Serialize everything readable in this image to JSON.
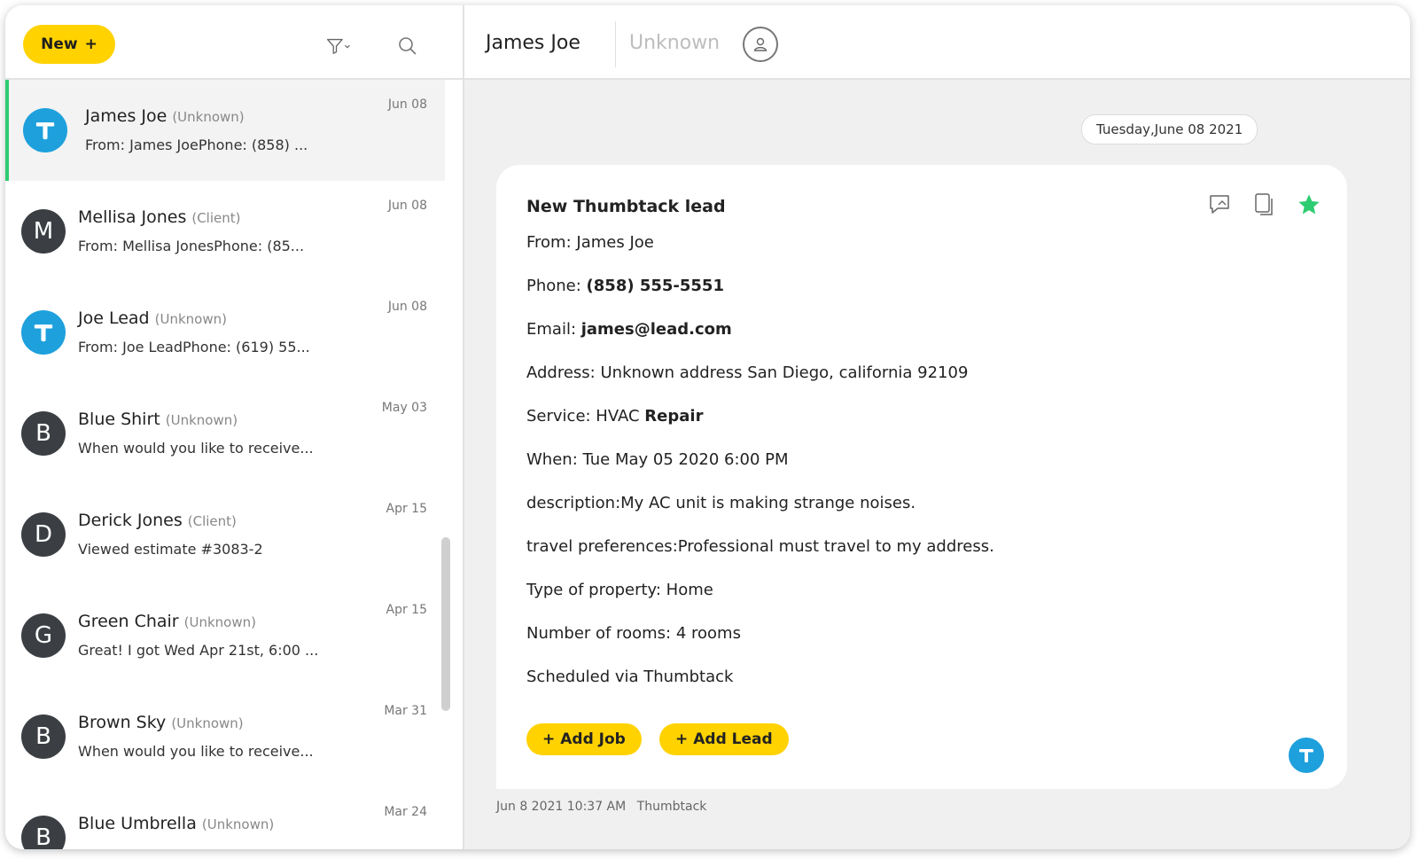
{
  "left": {
    "new_button": "New",
    "new_plus": "+",
    "conversations": [
      {
        "name": "James Joe",
        "role": "(Unknown)",
        "preview": "From: James JoePhone: (858) ...",
        "date": "Jun 08",
        "avatar": "T",
        "source": "thumbtack",
        "selected": true
      },
      {
        "name": "Mellisa Jones",
        "role": "(Client)",
        "preview": "From: Mellisa JonesPhone: (85...",
        "date": "Jun 08",
        "avatar": "M",
        "source": "letter"
      },
      {
        "name": "Joe Lead",
        "role": "(Unknown)",
        "preview": "From: Joe LeadPhone: (619) 55...",
        "date": "Jun 08",
        "avatar": "T",
        "source": "thumbtack"
      },
      {
        "name": "Blue Shirt",
        "role": "(Unknown)",
        "preview": "When would you like to receive...",
        "date": "May 03",
        "avatar": "B",
        "source": "letter"
      },
      {
        "name": "Derick Jones",
        "role": "(Client)",
        "preview": "Viewed estimate #3083-2",
        "date": "Apr 15",
        "avatar": "D",
        "source": "letter"
      },
      {
        "name": "Green Chair",
        "role": "(Unknown)",
        "preview": "Great! I got Wed Apr 21st, 6:00 ...",
        "date": "Apr 15",
        "avatar": "G",
        "source": "letter"
      },
      {
        "name": "Brown Sky",
        "role": "(Unknown)",
        "preview": "When would you like to receive...",
        "date": "Mar 31",
        "avatar": "B",
        "source": "letter"
      },
      {
        "name": "Blue Umbrella",
        "role": "(Unknown)",
        "preview": "",
        "date": "Mar 24",
        "avatar": "B",
        "source": "letter"
      }
    ]
  },
  "header": {
    "contact_name": "James Joe",
    "contact_status": "Unknown"
  },
  "thread": {
    "date_label": "Tuesday,June 08 2021",
    "message": {
      "title": "New Thumbtack lead",
      "lines": [
        {
          "label": "From: ",
          "value": "James Joe",
          "bold": false
        },
        {
          "label": "Phone: ",
          "value": "(858) 555-5551",
          "bold": true
        },
        {
          "label": "Email: ",
          "value": "james@lead.com",
          "bold": true
        },
        {
          "label": "Address: ",
          "value": "Unknown address San Diego, california 92109",
          "bold": false
        },
        {
          "label": "Service: HVAC ",
          "value": "Repair",
          "bold": true
        },
        {
          "label": "When: ",
          "value": "Tue May 05 2020 6:00 PM",
          "bold": false
        },
        {
          "label": "description:",
          "value": "My AC unit is making strange noises.",
          "bold": false
        },
        {
          "label": "travel preferences:",
          "value": "Professional must travel to my address.",
          "bold": false
        },
        {
          "label": "Type of property: ",
          "value": "Home",
          "bold": false
        },
        {
          "label": "Number of rooms: ",
          "value": "4 rooms",
          "bold": false
        },
        {
          "label": "",
          "value": "Scheduled via Thumbtack",
          "bold": false
        }
      ],
      "add_job": "Add Job",
      "add_lead": "Add Lead",
      "plus": "+",
      "timestamp": "Jun 8 2021 10:37 AM",
      "source": "Thumbtack"
    }
  },
  "colors": {
    "accent_yellow": "#ffd200",
    "thumbtack_blue": "#1ea0dc",
    "selected_green": "#2ecc71",
    "star_green": "#2ecc71"
  },
  "icons": {
    "filter": "filter-icon",
    "search": "search-icon",
    "contact": "user-icon",
    "reply": "reply-icon",
    "copy": "copy-icon",
    "star": "star-icon",
    "thumbtack": "thumbtack-icon"
  }
}
